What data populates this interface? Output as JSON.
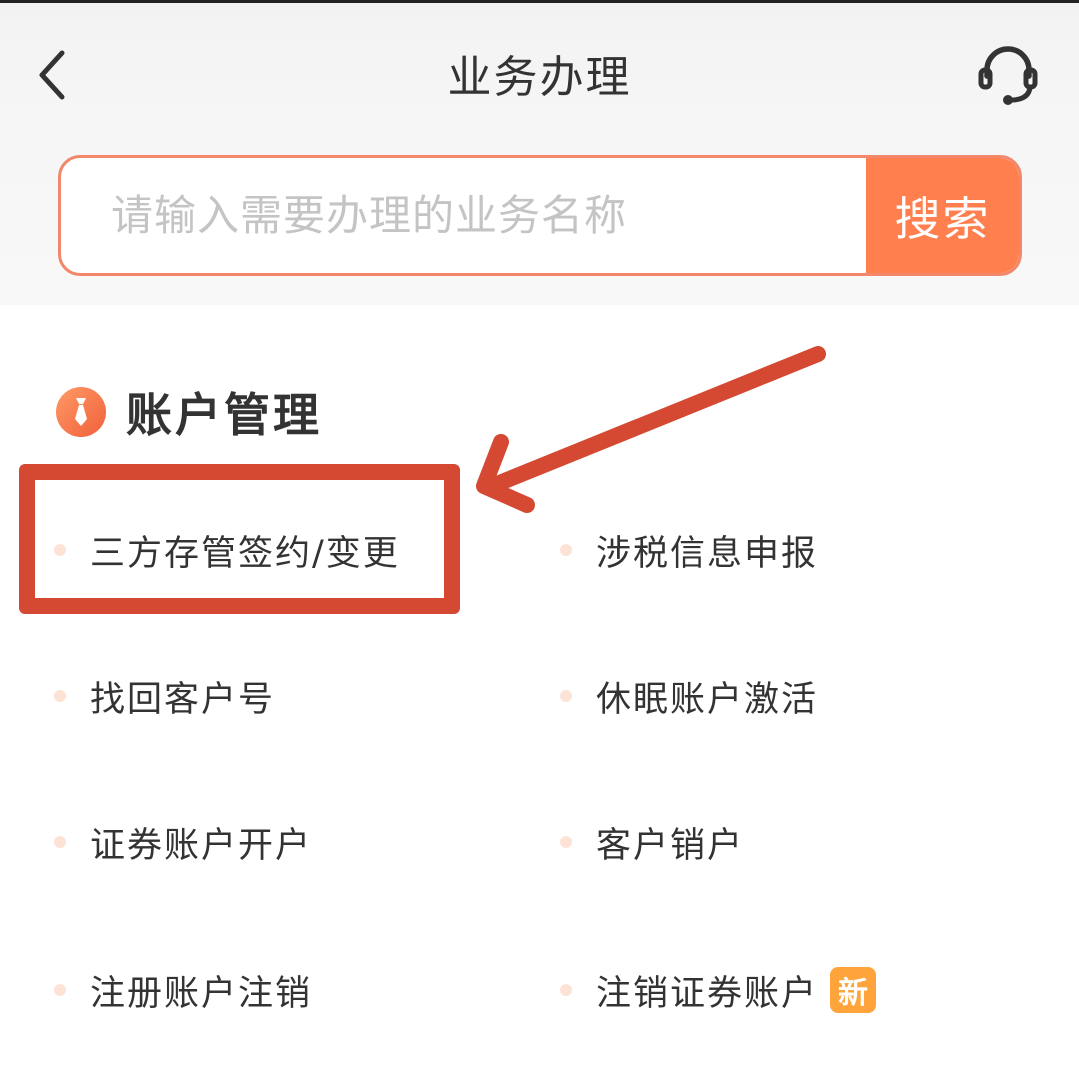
{
  "header": {
    "title": "业务办理",
    "back_icon": "chevron-left-icon",
    "support_icon": "headset-icon"
  },
  "search": {
    "placeholder": "请输入需要办理的业务名称",
    "value": "",
    "button_label": "搜索"
  },
  "section": {
    "title": "账户管理",
    "icon": "tie-icon"
  },
  "services": {
    "items": [
      {
        "label": "三方存管签约/变更"
      },
      {
        "label": "涉税信息申报"
      },
      {
        "label": "找回客户号"
      },
      {
        "label": "休眠账户激活"
      },
      {
        "label": "证券账户开户"
      },
      {
        "label": "客户销户"
      },
      {
        "label": "注册账户注销"
      },
      {
        "label": "注销证券账户",
        "badge": "新"
      }
    ]
  },
  "colors": {
    "accent": "#ff7f4f",
    "search_border": "#f2876a",
    "annotation": "#d54832",
    "badge": "#ffa43a",
    "bullet": "#fde3d6",
    "text": "#333333"
  }
}
